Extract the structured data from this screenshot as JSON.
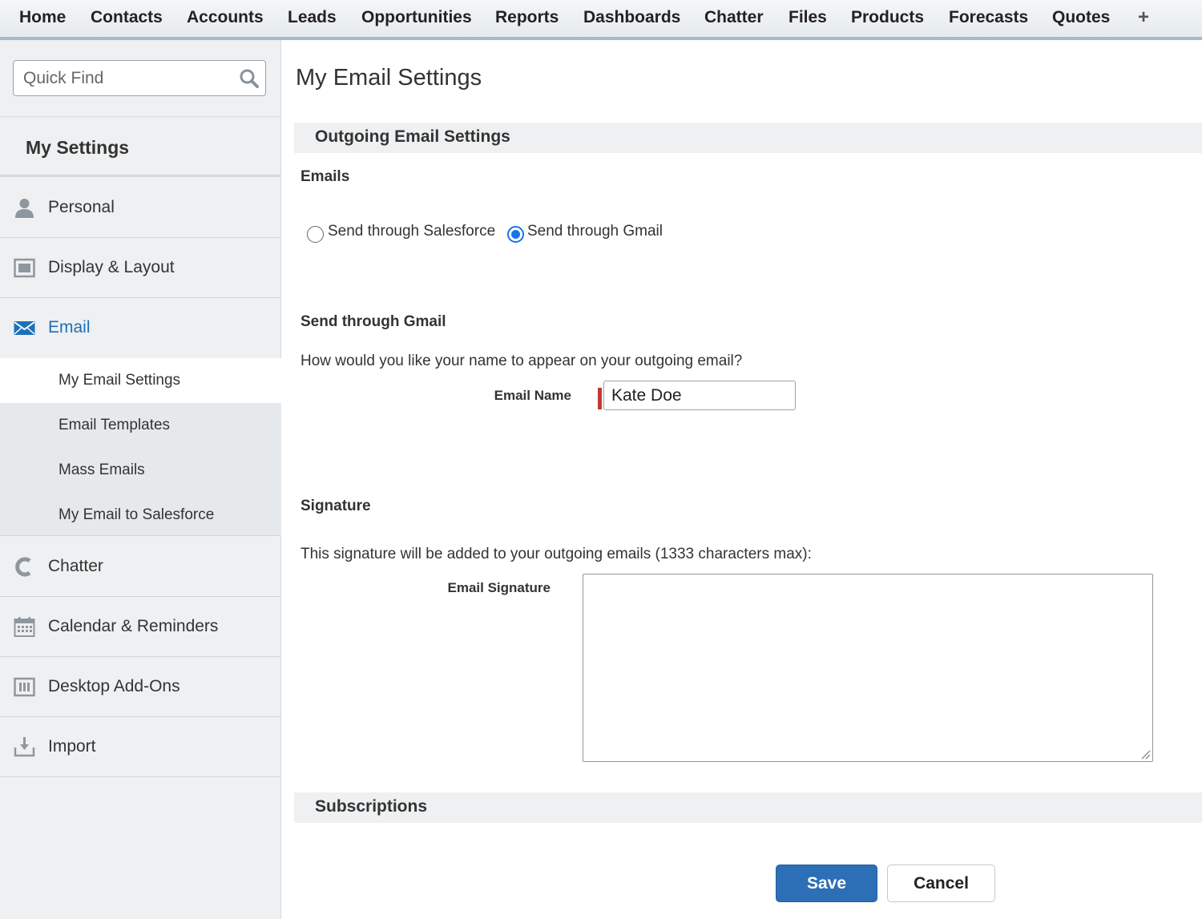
{
  "nav": {
    "tabs": [
      "Home",
      "Contacts",
      "Accounts",
      "Leads",
      "Opportunities",
      "Reports",
      "Dashboards",
      "Chatter",
      "Files",
      "Products",
      "Forecasts",
      "Quotes"
    ],
    "plus_label": "+"
  },
  "sidebar": {
    "search_placeholder": "Quick Find",
    "search_icon": "search-icon",
    "heading": "My Settings",
    "items": [
      {
        "label": "Personal",
        "icon": "person-icon"
      },
      {
        "label": "Display & Layout",
        "icon": "layout-icon"
      },
      {
        "label": "Email",
        "icon": "envelope-icon",
        "active": true
      },
      {
        "label": "Chatter",
        "icon": "chatter-icon"
      },
      {
        "label": "Calendar & Reminders",
        "icon": "calendar-icon"
      },
      {
        "label": "Desktop Add-Ons",
        "icon": "desktop-addons-icon"
      },
      {
        "label": "Import",
        "icon": "import-icon"
      }
    ],
    "email_subitems": [
      "My Email Settings",
      "Email Templates",
      "Mass Emails",
      "My Email to Salesforce"
    ],
    "selected_subitem": "My Email Settings"
  },
  "main": {
    "title": "My Email Settings",
    "outgoing_section": "Outgoing Email Settings",
    "emails_heading": "Emails",
    "radio_options": [
      "Send through Salesforce",
      "Send through Gmail"
    ],
    "radio_selected": "Send through Gmail",
    "gmail_heading": "Send through Gmail",
    "name_question": "How would you like your name to appear on your outgoing email?",
    "email_name_label": "Email Name",
    "email_name_value": "Kate Doe",
    "signature_heading": "Signature",
    "signature_note": "This signature will be added to your outgoing emails (1333 characters max):",
    "signature_label": "Email Signature",
    "signature_value": "",
    "subscriptions_section": "Subscriptions",
    "save_label": "Save",
    "cancel_label": "Cancel"
  },
  "colors": {
    "accent": "#1b71b9",
    "save_button": "#2d6fb7",
    "required": "#c23934",
    "radio_selected": "#1a73e8"
  }
}
